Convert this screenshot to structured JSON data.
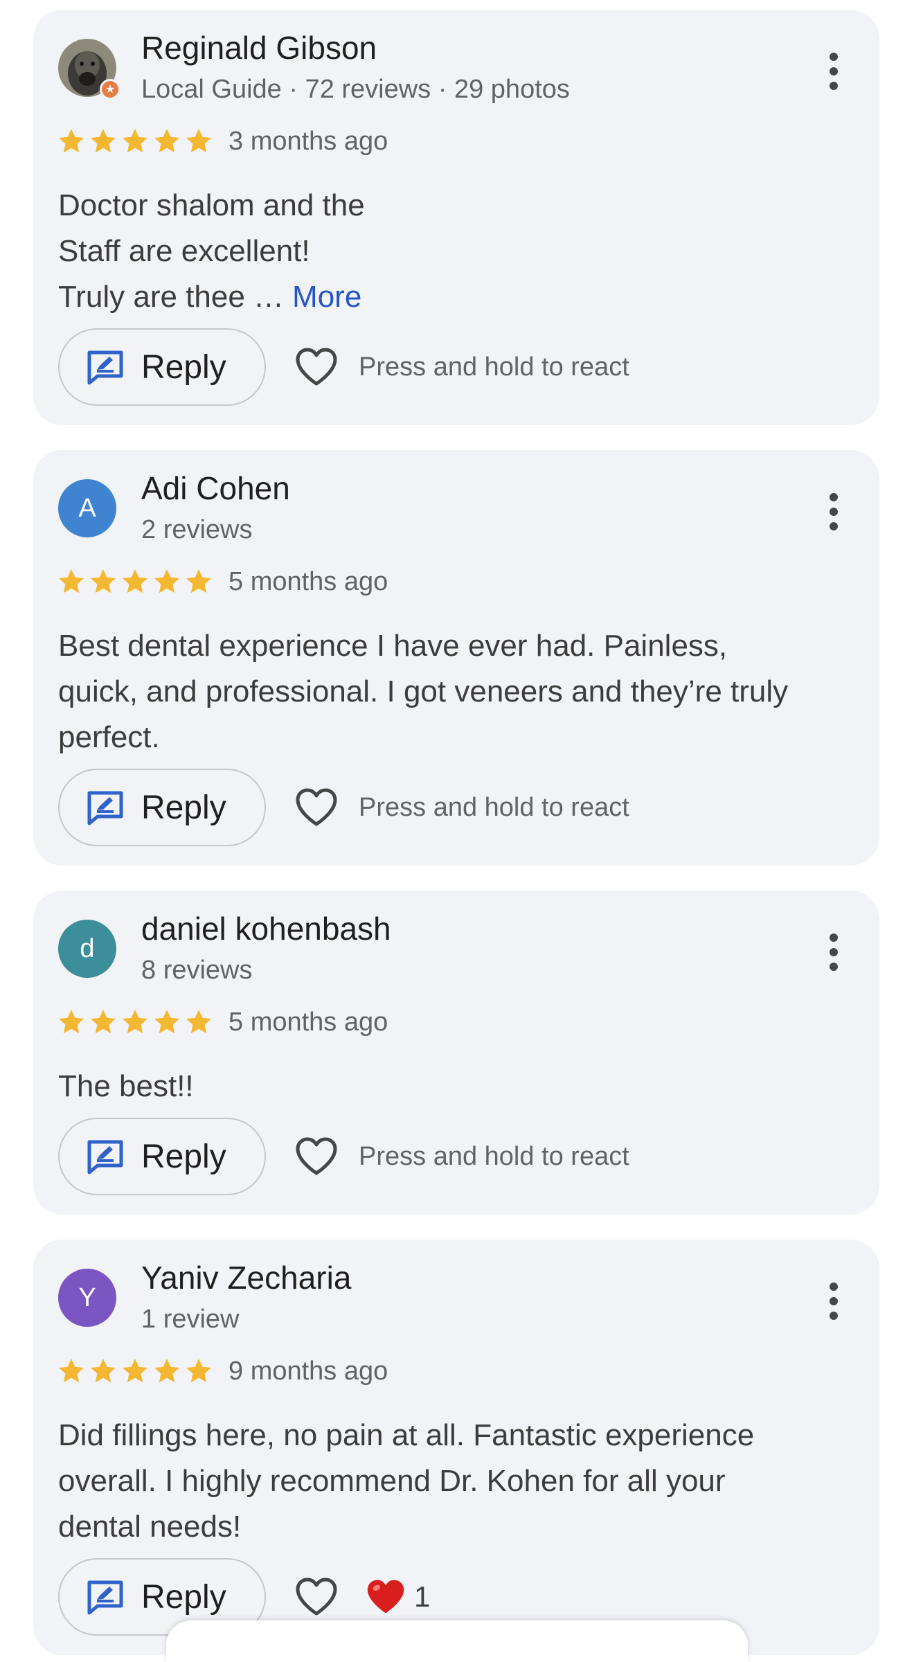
{
  "reviews": [
    {
      "name": "Reginald Gibson",
      "meta": "Local Guide · 72 reviews · 29 photos",
      "avatar_letter": "",
      "avatar_color": "#6b6659",
      "local_guide_badge": true,
      "rating": 5,
      "date": "3 months ago",
      "text_lines": [
        "Doctor shalom and the",
        "Staff are excellent!",
        "Truly are thee …"
      ],
      "more_label": "More",
      "reply_label": "Reply",
      "react_hint": "Press and hold to react"
    },
    {
      "name": "Adi Cohen",
      "meta": "2 reviews",
      "avatar_letter": "A",
      "avatar_color": "#3f84d1",
      "rating": 5,
      "date": "5 months ago",
      "text_lines": [
        "Best dental experience I have ever had. Painless,",
        "quick, and professional. I got veneers and they’re truly",
        "perfect."
      ],
      "reply_label": "Reply",
      "react_hint": "Press and hold to react"
    },
    {
      "name": "daniel kohenbash",
      "meta": "8 reviews",
      "avatar_letter": "d",
      "avatar_color": "#3d8e9b",
      "rating": 5,
      "date": "5 months ago",
      "text_lines": [
        "The best!!"
      ],
      "reply_label": "Reply",
      "react_hint": "Press and hold to react"
    },
    {
      "name": "Yaniv Zecharia",
      "meta": "1 review",
      "avatar_letter": "Y",
      "avatar_color": "#7b55c2",
      "rating": 5,
      "date": "9 months ago",
      "text_lines": [
        "Did fillings here, no pain at all. Fantastic experience",
        "overall. I highly recommend Dr. Kohen for all your",
        "dental needs!"
      ],
      "reply_label": "Reply",
      "reaction_count": "1"
    }
  ],
  "colors": {
    "star": "#f4b731",
    "link": "#2457c5",
    "reply_icon": "#2f63c9"
  }
}
